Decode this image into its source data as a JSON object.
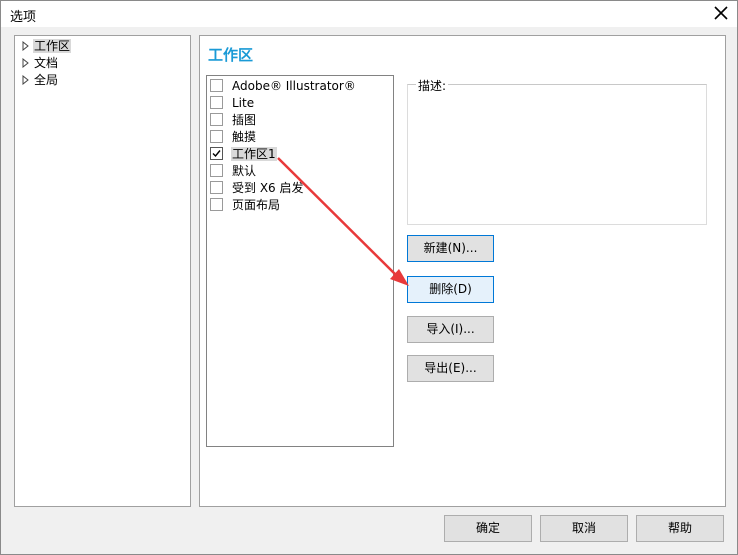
{
  "window": {
    "title": "选项"
  },
  "tree": {
    "items": [
      {
        "label": "工作区",
        "selected": true
      },
      {
        "label": "文档",
        "selected": false
      },
      {
        "label": "全局",
        "selected": false
      }
    ]
  },
  "panel": {
    "title": "工作区",
    "workspaces": [
      {
        "label": "Adobe® Illustrator®",
        "checked": false
      },
      {
        "label": "Lite",
        "checked": false
      },
      {
        "label": "插图",
        "checked": false
      },
      {
        "label": "触摸",
        "checked": false
      },
      {
        "label": "工作区1",
        "checked": true
      },
      {
        "label": "默认",
        "checked": false
      },
      {
        "label": "受到 X6 启发",
        "checked": false
      },
      {
        "label": "页面布局",
        "checked": false
      }
    ],
    "description_label": "描述:",
    "buttons": {
      "new": "新建(N)...",
      "delete": "删除(D)",
      "import": "导入(I)...",
      "export": "导出(E)..."
    }
  },
  "footer": {
    "ok": "确定",
    "cancel": "取消",
    "help": "帮助"
  },
  "annotation": {
    "arrow_color": "#e8393a"
  },
  "colors": {
    "accent": "#1a9ad6"
  }
}
